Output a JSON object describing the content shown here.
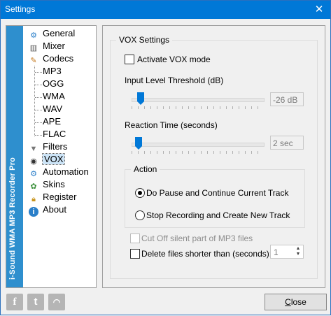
{
  "window": {
    "title": "Settings",
    "close_icon": "close-icon"
  },
  "sidebar": {
    "brand": "i-Sound WMA MP3 Recorder Pro",
    "items": [
      {
        "label": "General",
        "icon": "gear-icon"
      },
      {
        "label": "Mixer",
        "icon": "mixer-icon"
      },
      {
        "label": "Codecs",
        "icon": "codecs-icon"
      },
      {
        "label": "Filters",
        "icon": "funnel-icon"
      },
      {
        "label": "VOX",
        "icon": "vox-icon"
      },
      {
        "label": "Automation",
        "icon": "automation-icon"
      },
      {
        "label": "Skins",
        "icon": "skins-icon"
      },
      {
        "label": "Register",
        "icon": "lock-icon"
      },
      {
        "label": "About",
        "icon": "info-icon"
      }
    ],
    "codecs": [
      "MP3",
      "OGG",
      "WMA",
      "WAV",
      "APE",
      "FLAC"
    ],
    "selected": "VOX"
  },
  "vox": {
    "group_title": "VOX Settings",
    "activate_label": "Activate VOX mode",
    "activate_checked": false,
    "threshold_label": "Input Level Threshold (dB)",
    "threshold_value": "-26 dB",
    "reaction_label": "Reaction Time (seconds)",
    "reaction_value": "2 sec",
    "action": {
      "title": "Action",
      "options": [
        "Do Pause and Continue Current Track",
        "Stop Recording and Create New Track"
      ],
      "selected_index": 0
    },
    "cutoff_label": "Cut Off silent part of MP3 files",
    "delete_label": "Delete files shorter than (seconds):",
    "delete_value": "1"
  },
  "footer": {
    "social": [
      "f",
      "t",
      "rss"
    ],
    "close_prefix": "",
    "close_underlined": "C",
    "close_rest": "lose"
  }
}
